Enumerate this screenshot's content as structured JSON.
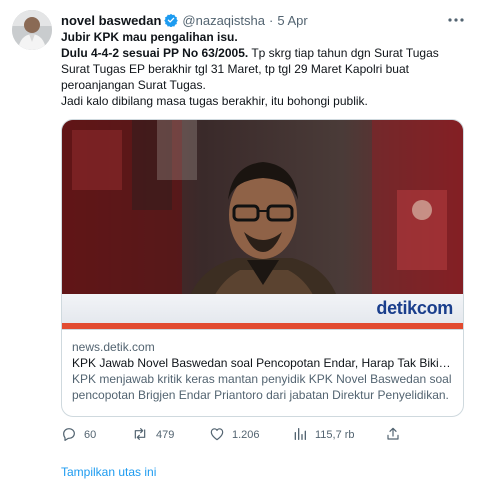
{
  "tweet": {
    "author_name": "novel baswedan",
    "handle": "@nazaqistsha",
    "separator": "·",
    "date": "5 Apr",
    "lines": [
      {
        "bold": "Jubir KPK mau pengalihan isu.",
        "rest": ""
      },
      {
        "bold": "Dulu 4-4-2 sesuai PP No 63/2005.",
        "rest": " Tp skrg tiap tahun dgn Surat Tugas"
      },
      {
        "bold": "",
        "rest": "Surat Tugas EP berakhir tgl 31 Maret, tp tgl 29 Maret Kapolri buat"
      },
      {
        "bold": "",
        "rest": "peroanjangan Surat Tugas."
      },
      {
        "bold": "",
        "rest": "Jadi kalo dibilang masa tugas berakhir, itu bohongi publik."
      }
    ]
  },
  "card": {
    "watermark": "detikcom",
    "domain": "news.detik.com",
    "title": "KPK Jawab Novel Baswedan soal Pencopotan Endar, Harap Tak Bikin Gaduh",
    "description": "KPK menjawab kritik keras mantan penyidik KPK Novel Baswedan soal pencopotan Brigjen Endar Priantoro dari jabatan Direktur Penyelidikan."
  },
  "actions": {
    "reply_count": "60",
    "retweet_count": "479",
    "like_count": "1.206",
    "views_count": "115,7 rb"
  },
  "show_thread": "Tampilkan utas ini",
  "colors": {
    "accent": "#1d9bf0",
    "text": "#0f1419",
    "secondary": "#536471",
    "border": "#cfd9de",
    "watermark_brand": "#1a3e8c"
  },
  "icons": [
    "verified-badge-icon",
    "more-options-icon",
    "reply-icon",
    "retweet-icon",
    "like-icon",
    "views-icon",
    "share-icon"
  ]
}
